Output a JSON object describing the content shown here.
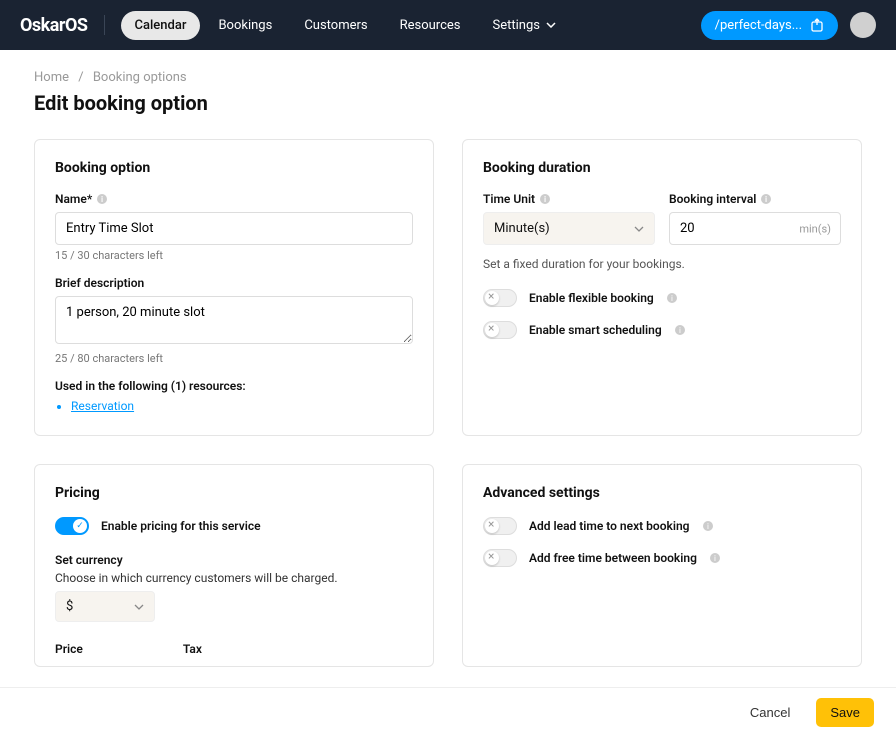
{
  "header": {
    "logo": "OskarOS",
    "nav": {
      "calendar": "Calendar",
      "bookings": "Bookings",
      "customers": "Customers",
      "resources": "Resources",
      "settings": "Settings"
    },
    "share_label": "/perfect-days..."
  },
  "breadcrumb": {
    "home": "Home",
    "options": "Booking options"
  },
  "page_title": "Edit booking option",
  "option": {
    "section_title": "Booking option",
    "name_label": "Name*",
    "name_value": "Entry Time Slot",
    "name_helper": "15 / 30 characters left",
    "desc_label": "Brief description",
    "desc_value": "1 person, 20 minute slot",
    "desc_helper": "25 / 80 characters left",
    "used_in_label": "Used in the following (1) resources:",
    "resource_link": "Reservation"
  },
  "duration": {
    "section_title": "Booking duration",
    "unit_label": "Time Unit",
    "unit_value": "Minute(s)",
    "interval_label": "Booking interval",
    "interval_value": "20",
    "interval_suffix": "min(s)",
    "hint": "Set a fixed duration for your bookings.",
    "flexible_label": "Enable flexible booking",
    "smart_label": "Enable smart scheduling"
  },
  "pricing": {
    "section_title": "Pricing",
    "enable_label": "Enable pricing for this service",
    "currency_label": "Set currency",
    "currency_hint": "Choose in which currency customers will be charged.",
    "currency_value": "$",
    "price_label": "Price",
    "tax_label": "Tax"
  },
  "advanced": {
    "section_title": "Advanced settings",
    "lead_label": "Add lead time to next booking",
    "free_label": "Add free time between booking"
  },
  "footer": {
    "cancel": "Cancel",
    "save": "Save"
  }
}
